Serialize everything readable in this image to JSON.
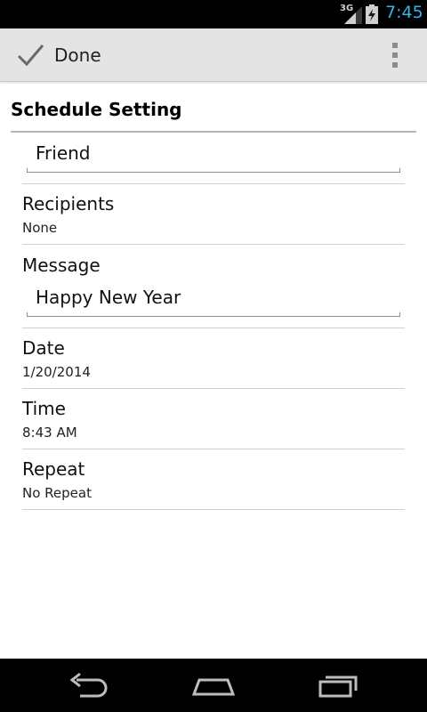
{
  "status_bar": {
    "network": "3G",
    "time": "7:45",
    "icons": [
      "signal-icon",
      "battery-charging-icon"
    ]
  },
  "action_bar": {
    "done_label": "Done",
    "icons": [
      "check-icon",
      "overflow-menu-icon"
    ]
  },
  "section": {
    "title": "Schedule Setting"
  },
  "form": {
    "name_value": "Friend",
    "recipients_label": "Recipients",
    "recipients_value": "None",
    "message_label": "Message",
    "message_value": "Happy New Year",
    "date_label": "Date",
    "date_value": "1/20/2014",
    "time_label": "Time",
    "time_value": "8:43 AM",
    "repeat_label": "Repeat",
    "repeat_value": "No Repeat"
  },
  "nav_bar": {
    "icons": [
      "back-icon",
      "home-icon",
      "recent-apps-icon"
    ]
  },
  "colors": {
    "status_clock": "#33b5e5",
    "action_bar_bg": "#e4e4e4",
    "divider": "#cfcfcf"
  }
}
